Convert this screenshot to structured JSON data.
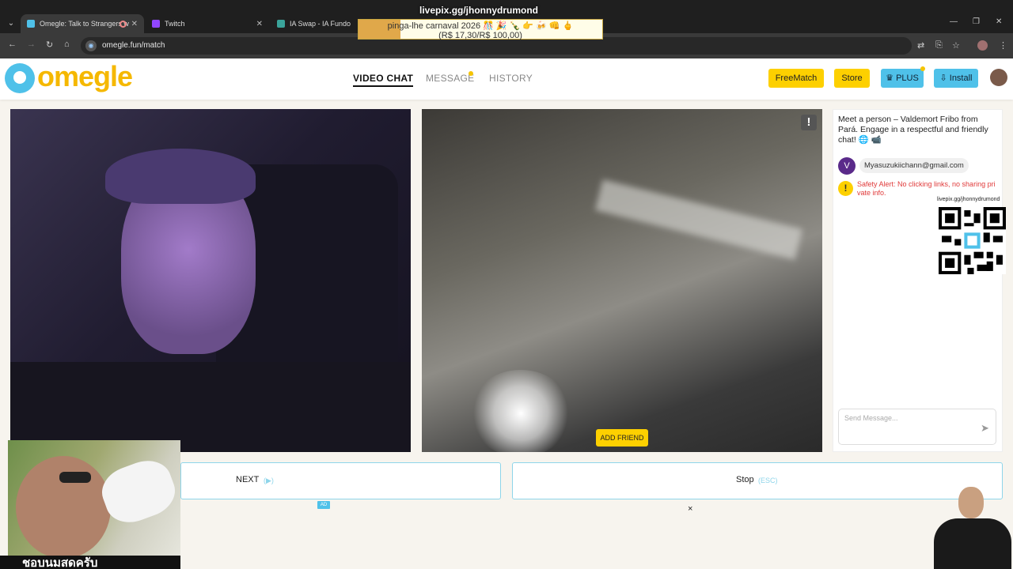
{
  "browser": {
    "tabs": [
      {
        "title": "Omegle: Talk to Strangers w",
        "active": true
      },
      {
        "title": "Twitch",
        "active": false
      },
      {
        "title": "IA Swap - IA Fundo",
        "active": false
      }
    ],
    "url": "omegle.fun/match"
  },
  "overlay": {
    "title": "livepix.gg/jhonnydrumond",
    "banner_line1": "pinga-lhe carnaval 2026 🎊 🎉 🍾 👉 🍻 👊 🖕",
    "banner_line2": "(R$ 17,30/R$ 100,00)",
    "progress": 0.173
  },
  "site": {
    "logo_text": "omegle",
    "nav": {
      "video_chat": "VIDEO CHAT",
      "message": "MESSAGE",
      "history": "HISTORY"
    },
    "buttons": {
      "freematch": "FreeMatch",
      "store": "Store",
      "plus": "♛ PLUS",
      "install": "⇩ Install"
    }
  },
  "video": {
    "report_icon": "!",
    "add_friend": "ADD FRIEND"
  },
  "chat": {
    "intro": "Meet a person – Valdemort Fribo from Pará. Engage in a respectful and friendly chat! 🌐 📹",
    "avatar_letter": "V",
    "message": "Myasuzukiichann@gmail.com",
    "safety_icon": "!",
    "safety": "Safety Alert: No clicking links, no sharing private info.",
    "qr_label": "livepix.gg/jhonnydrumond",
    "input_placeholder": "Send Message...",
    "send_icon": "➤"
  },
  "controls": {
    "next_label": "NEXT",
    "next_hint": "(▶)",
    "stop_label": "Stop",
    "stop_hint": "(ESC)",
    "ad_badge": "AD",
    "ad_close": "×"
  },
  "stream": {
    "caption": "ชอบนมสดครับ"
  },
  "colors": {
    "accent_yellow": "#fdd000",
    "accent_blue": "#4fc1e9",
    "alert_red": "#e03a3a"
  }
}
